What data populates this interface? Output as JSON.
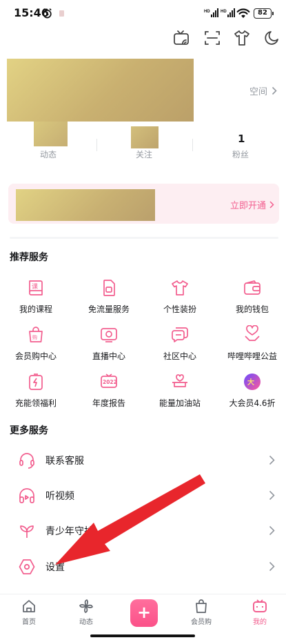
{
  "status_bar": {
    "time": "15:46",
    "battery": "82",
    "signal_1": "HD",
    "signal_2": "HD"
  },
  "profile": {
    "space_label": "空间"
  },
  "stats": [
    {
      "label": "动态",
      "value": ""
    },
    {
      "label": "关注",
      "value": ""
    },
    {
      "label": "粉丝",
      "value": "1"
    }
  ],
  "vip": {
    "action_label": "立即开通"
  },
  "recommended": {
    "title": "推荐服务",
    "items": [
      {
        "label": "我的课程",
        "icon": "course-icon"
      },
      {
        "label": "免流量服务",
        "icon": "sim-card-icon"
      },
      {
        "label": "个性装扮",
        "icon": "tshirt-icon"
      },
      {
        "label": "我的钱包",
        "icon": "wallet-icon"
      },
      {
        "label": "会员购中心",
        "icon": "shopping-bag-icon"
      },
      {
        "label": "直播中心",
        "icon": "live-tv-icon"
      },
      {
        "label": "社区中心",
        "icon": "chat-icon"
      },
      {
        "label": "哔哩哔哩公益",
        "icon": "heart-hands-icon"
      },
      {
        "label": "充能领福利",
        "icon": "battery-icon"
      },
      {
        "label": "年度报告",
        "icon": "tv-2022-icon"
      },
      {
        "label": "能量加油站",
        "icon": "energy-station-icon"
      },
      {
        "label": "大会员4.6折",
        "icon": "vip-promo-icon"
      }
    ]
  },
  "tv_badge": "2022",
  "more_services": {
    "title": "更多服务",
    "items": [
      {
        "label": "联系客服",
        "icon": "headset-icon"
      },
      {
        "label": "听视频",
        "icon": "headphones-icon"
      },
      {
        "label": "青少年守护",
        "icon": "sprout-icon"
      },
      {
        "label": "设置",
        "icon": "gear-icon"
      }
    ]
  },
  "bottom_nav": {
    "home": "首页",
    "dynamic": "动态",
    "plus": "+",
    "mall": "会员购",
    "mine": "我的"
  },
  "colors": {
    "accent": "#f25d8e",
    "text": "#18191c",
    "muted": "#9499a0",
    "arrow": "#e8262c"
  }
}
